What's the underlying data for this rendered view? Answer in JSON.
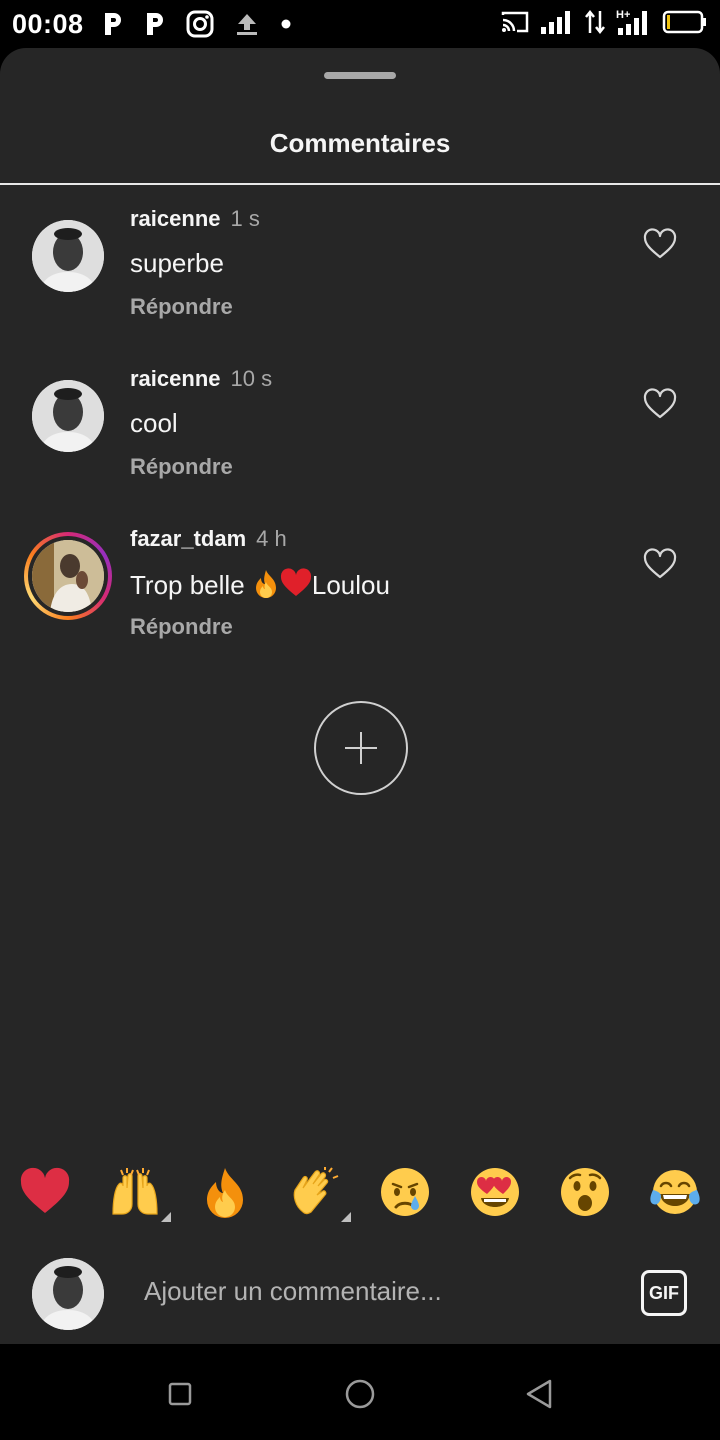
{
  "status_bar": {
    "time": "00:08",
    "left_icons": [
      "p-notification-icon",
      "p-notification-icon",
      "instagram-icon",
      "upload-icon",
      "dot-icon"
    ],
    "right_icons": [
      "cast-icon",
      "signal-icon",
      "data-arrows-icon",
      "hplus-signal-icon",
      "battery-icon"
    ],
    "network_label": "H+"
  },
  "sheet": {
    "title": "Commentaires"
  },
  "comments": [
    {
      "user": "raicenne",
      "time": "1 s",
      "text": "superbe",
      "reply_label": "Répondre",
      "has_story_ring": false
    },
    {
      "user": "raicenne",
      "time": "10 s",
      "text": "cool",
      "reply_label": "Répondre",
      "has_story_ring": false
    },
    {
      "user": "fazar_tdam",
      "time": "4 h",
      "text_before": "Trop belle ",
      "emojis": [
        "fire",
        "red-heart"
      ],
      "text_after": "Loulou",
      "reply_label": "Répondre",
      "has_story_ring": true
    }
  ],
  "add_button": {
    "icon": "plus-icon"
  },
  "emoji_bar": [
    "red-heart",
    "raising-hands",
    "fire",
    "clapping-hands",
    "crying-face",
    "heart-eyes",
    "astonished-face",
    "tears-of-joy"
  ],
  "composer": {
    "placeholder": "Ajouter un commentaire...",
    "gif_label": "GIF"
  },
  "nav_bar": [
    "recents-square-icon",
    "home-circle-icon",
    "back-triangle-icon"
  ],
  "colors": {
    "sheet_bg": "#262626",
    "text_primary": "#f5f5f5",
    "text_secondary": "#a8a8a8",
    "heart_red": "#e0202a",
    "fire_orange": "#f4900c"
  }
}
